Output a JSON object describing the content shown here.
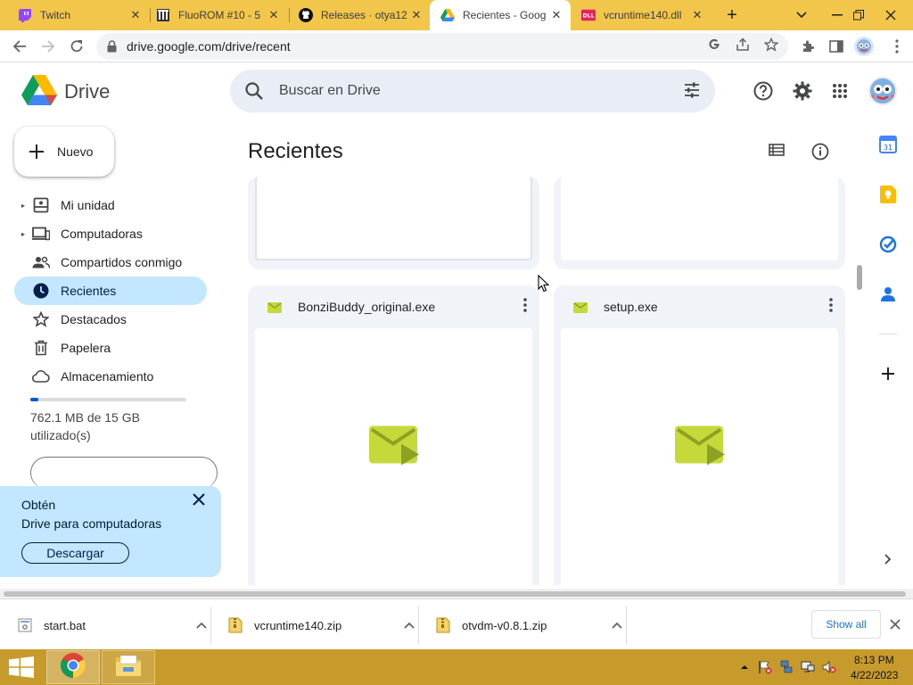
{
  "browser": {
    "tabs": [
      {
        "title": "Twitch",
        "favicon": "twitch-icon",
        "active": false
      },
      {
        "title": "FluoROM #10 - 5",
        "favicon": "page-icon",
        "active": false
      },
      {
        "title": "Releases · otya12",
        "favicon": "github-icon",
        "active": false
      },
      {
        "title": "Recientes - Goog",
        "favicon": "google-drive-icon",
        "active": true
      },
      {
        "title": "vcruntime140.dll",
        "favicon": "dll-icon",
        "active": false
      }
    ],
    "new_tab": "+",
    "url": "drive.google.com/drive/recent"
  },
  "drive": {
    "app_name": "Drive",
    "search_placeholder": "Buscar en Drive",
    "new_button": "Nuevo",
    "nav": [
      {
        "label": "Mi unidad",
        "icon": "my-drive-icon",
        "expandable": true,
        "active": false
      },
      {
        "label": "Computadoras",
        "icon": "computer-icon",
        "expandable": true,
        "active": false
      },
      {
        "label": "Compartidos conmigo",
        "icon": "shared-icon",
        "expandable": false,
        "active": false
      },
      {
        "label": "Recientes",
        "icon": "clock-icon",
        "expandable": false,
        "active": true
      },
      {
        "label": "Destacados",
        "icon": "star-icon",
        "expandable": false,
        "active": false
      },
      {
        "label": "Papelera",
        "icon": "trash-icon",
        "expandable": false,
        "active": false
      },
      {
        "label": "Almacenamiento",
        "icon": "cloud-icon",
        "expandable": false,
        "active": false
      }
    ],
    "storage": {
      "used_fraction": 0.05,
      "text_line1": "762.1 MB de 15 GB",
      "text_line2": "utilizado(s)"
    },
    "promo": {
      "line1": "Obtén",
      "line2": "Drive para computadoras",
      "button": "Descargar"
    },
    "main_title": "Recientes",
    "files": [
      {
        "name": "BonziBuddy_original.exe",
        "icon": "binary-file-icon"
      },
      {
        "name": "setup.exe",
        "icon": "binary-file-icon"
      }
    ]
  },
  "downloads": {
    "items": [
      {
        "name": "start.bat",
        "icon": "bat-file-icon"
      },
      {
        "name": "vcruntime140.zip",
        "icon": "zip-file-icon"
      },
      {
        "name": "otvdm-v0.8.1.zip",
        "icon": "zip-file-icon"
      }
    ],
    "show_all": "Show all"
  },
  "taskbar": {
    "time": "8:13 PM",
    "date": "4/22/2023"
  },
  "colors": {
    "tabstrip": "#f2c64a",
    "taskbar": "#c79a2c",
    "active_nav": "#c2e7ff",
    "exe_icon": "#c5d93b"
  }
}
